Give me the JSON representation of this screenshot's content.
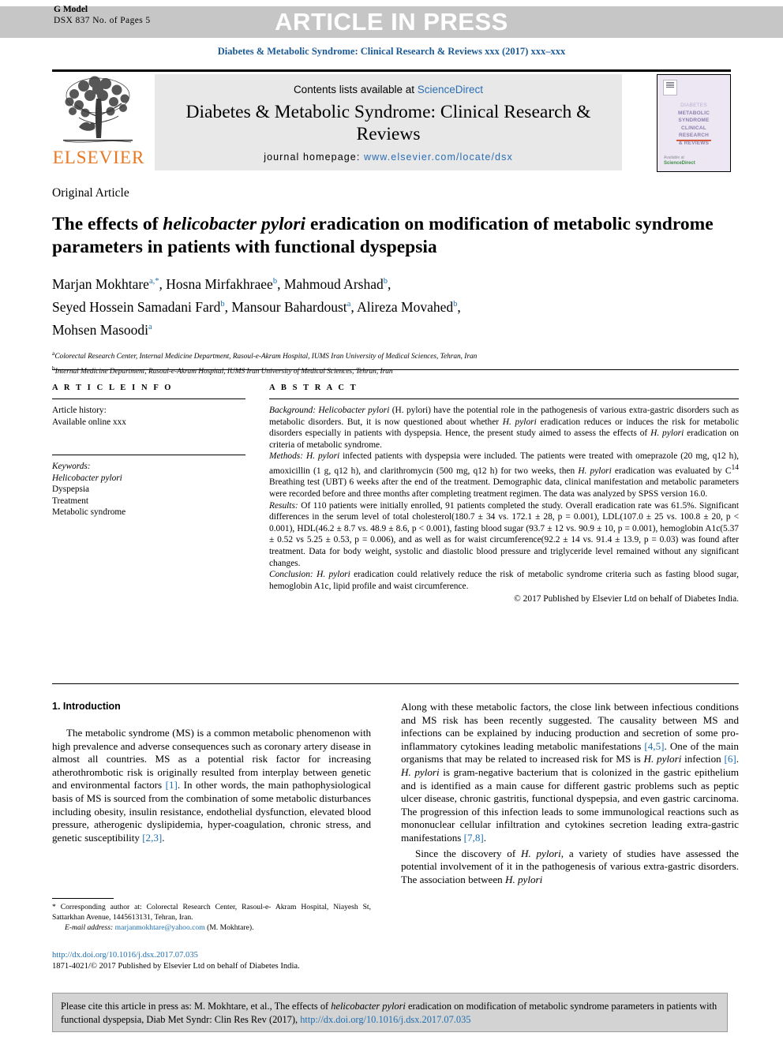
{
  "banner": {
    "press_text": "ARTICLE IN PRESS",
    "g_model_line1": "G Model",
    "g_model_line2": "DSX 837 No. of Pages 5",
    "bg_color": "#c6c6c6"
  },
  "running_head": {
    "text": "Diabetes & Metabolic Syndrome: Clinical Research & Reviews xxx (2017) xxx–xxx",
    "color": "#1c5a96"
  },
  "masthead": {
    "publisher_logo_label": "ELSEVIER",
    "publisher_logo_color": "#e87722",
    "contents_prefix": "Contents lists available at ",
    "contents_link": "ScienceDirect",
    "journal_title": "Diabetes & Metabolic Syndrome: Clinical Research & Reviews",
    "homepage_label": "journal homepage: ",
    "homepage_url": "www.elsevier.com/locate/dsx",
    "link_color": "#2a6eb5",
    "cover": {
      "line1": "DIABETES",
      "line2": "METABOLIC",
      "line3": "SYNDROME",
      "line4": "CLINICAL",
      "line5": "RESEARCH",
      "line6": "& REVIEWS",
      "footer_label": "Available at",
      "footer_brand": "ScienceDirect",
      "background": "#ece7f2"
    }
  },
  "article": {
    "type": "Original Article",
    "title_part1": "The effects of ",
    "title_italic": "helicobacter pylori",
    "title_part2": " eradication on modification of metabolic syndrome parameters in patients with functional dyspepsia",
    "authors_line1": "Marjan Mokhtare",
    "authors_line1_sup": "a,*",
    "authors_line1b": ", Hosna Mirfakhraee",
    "authors_line1b_sup": "b",
    "authors_line1c": ", Mahmoud Arshad",
    "authors_line1c_sup": "b",
    "authors_line2": "Seyed Hossein Samadani Fard",
    "authors_line2_sup": "b",
    "authors_line2b": ", Mansour Bahardoust",
    "authors_line2b_sup": "a",
    "authors_line2c": ", Alireza Movahed",
    "authors_line2c_sup": "b",
    "authors_line3": "Mohsen Masoodi",
    "authors_line3_sup": "a",
    "affiliation_a_sup": "a",
    "affiliation_a": "Colorectal Research Center, Internal Medicine Department, Rasoul-e-Akram Hospital, IUMS Iran University of Medical Sciences, Tehran, Iran",
    "affiliation_b_sup": "b",
    "affiliation_b": "Internal Medicine Department, Rasoul-e-Akram Hospital, IUMS Iran University of Medical Sciences, Tehran, Iran"
  },
  "article_info": {
    "heading": "A R T I C L E   I N F O",
    "history_label": "Article history:",
    "history_value": "Available online xxx",
    "keywords_label": "Keywords:",
    "keywords": [
      "Helicobacter pylori",
      "Dyspepsia",
      "Treatment",
      "Metabolic syndrome"
    ]
  },
  "abstract": {
    "heading": "A B S T R A C T",
    "background_label": "Background:",
    "background_text_1": " Helicobacter pylori",
    "background_text_2": " (H. pylori) have the potential role in the pathogenesis of various extra-gastric disorders such as metabolic disorders. But, it is now questioned about whether ",
    "background_italic_2": "H. pylori",
    "background_text_3": " eradication reduces or induces the risk for metabolic disorders especially in patients with dyspepsia. Hence, the present study aimed to assess the effects of ",
    "background_italic_3": "H. pylori",
    "background_text_4": " eradication on criteria of metabolic syndrome.",
    "methods_label": "Methods:",
    "methods_italic_1": " H. pylori",
    "methods_text_1": " infected patients with dyspepsia were included. The patients were treated with omeprazole (20 mg, q12 h), amoxicillin (1 g, q12 h), and clarithromycin (500 mg, q12 h) for two weeks, then ",
    "methods_italic_2": "H. pylori",
    "methods_text_2": " eradication was evaluated by C",
    "methods_sup": "14",
    "methods_text_3": " Breathing test (UBT) 6 weeks after the end of the treatment. Demographic data, clinical manifestation and metabolic parameters were recorded before and three months after completing treatment regimen. The data was analyzed by SPSS version 16.0.",
    "results_label": "Results:",
    "results_text": " Of 110 patients were initially enrolled, 91 patients completed the study. Overall eradication rate was 61.5%. Significant differences in the serum level of total cholesterol(180.7 ± 34 vs. 172.1 ± 28, p = 0.001), LDL(107.0 ± 25 vs. 100.8 ± 20, p < 0.001), HDL(46.2 ± 8.7 vs. 48.9 ± 8.6, p < 0.001), fasting blood sugar (93.7 ± 12 vs. 90.9 ± 10, p = 0.001), hemoglobin A1c(5.37 ± 0.52 vs 5.25 ± 0.53, p = 0.006), and as well as for waist circumference(92.2 ± 14 vs. 91.4 ± 13.9, p = 0.03) was found after treatment. Data for body weight, systolic and diastolic blood pressure and triglyceride level remained without any significant changes.",
    "conclusion_label": "Conclusion:",
    "conclusion_italic": " H. pylori",
    "conclusion_text": " eradication could relatively reduce the risk of metabolic syndrome criteria such as fasting blood sugar, hemoglobin A1c, lipid profile and waist circumference.",
    "copyright": "© 2017 Published by Elsevier Ltd on behalf of Diabetes India."
  },
  "introduction": {
    "heading": "1. Introduction",
    "left_p1_a": "The metabolic syndrome (MS) is a common metabolic phenomenon with high prevalence and adverse consequences such as coronary artery disease in almost all countries. MS as a potential risk factor for increasing atherothrombotic risk is originally resulted from interplay between genetic and environmental factors ",
    "left_p1_ref1": "[1]",
    "left_p1_b": ". In other words, the main pathophysiological basis of MS is sourced from the combination of some metabolic disturbances including obesity, insulin resistance, endothelial dysfunction, elevated blood pressure, atherogenic dyslipidemia, hyper-coagulation, chronic stress, and genetic susceptibility ",
    "left_p1_ref2": "[2,3]",
    "left_p1_c": ".",
    "right_p1_a": "Along with these metabolic factors, the close link between infectious conditions and MS risk has been recently suggested. The causality between MS and infections can be explained by inducing production and secretion of some pro-inflammatory cytokines leading metabolic manifestations ",
    "right_p1_ref1": "[4,5]",
    "right_p1_b": ". One of the main organisms that may be related to increased risk for MS is ",
    "right_p1_italic1": "H. pylori",
    "right_p1_c": " infection ",
    "right_p1_ref2": "[6]",
    "right_p1_d": ". ",
    "right_p1_italic2": "H. pylori",
    "right_p1_e": " is gram-negative bacterium that is colonized in the gastric epithelium and is identified as a main cause for different gastric problems such as peptic ulcer disease, chronic gastritis, functional dyspepsia, and even gastric carcinoma. The progression of this infection leads to some immunological reactions such as mononuclear cellular infiltration and cytokines secretion leading extra-gastric manifestations ",
    "right_p1_ref3": "[7,8]",
    "right_p1_f": ".",
    "right_p2_a": "Since the discovery of ",
    "right_p2_italic1": "H. pylori",
    "right_p2_b": ", a variety of studies have assessed the potential involvement of it in the pathogenesis of various extra-gastric disorders. The association between ",
    "right_p2_italic2": "H. pylori"
  },
  "footnotes": {
    "star": "*",
    "corresponding": " Corresponding author at: Colorectal Research Center, Rasoul-e- Akram Hospital, Niayesh St, Sattarkhan Avenue, 1445613131, Tehran, Iran.",
    "email_label": "E-mail address:",
    "email_value": " marjanmokhtare@yahoo.com",
    "email_suffix": " (M. Mokhtare).",
    "doi": "http://dx.doi.org/10.1016/j.dsx.2017.07.035",
    "issn_line": "1871-4021/© 2017 Published by Elsevier Ltd on behalf of Diabetes India."
  },
  "cite_box": {
    "text_a": "Please cite this article in press as: M. Mokhtare, et al., The effects of ",
    "text_italic": "helicobacter pylori",
    "text_b": " eradication on modification of metabolic syndrome parameters in patients with functional dyspepsia, Diab Met Syndr: Clin Res Rev (2017), ",
    "doi": "http://dx.doi.org/10.1016/j.dsx.2017.07.035",
    "bg_color": "#d3d3d3"
  }
}
